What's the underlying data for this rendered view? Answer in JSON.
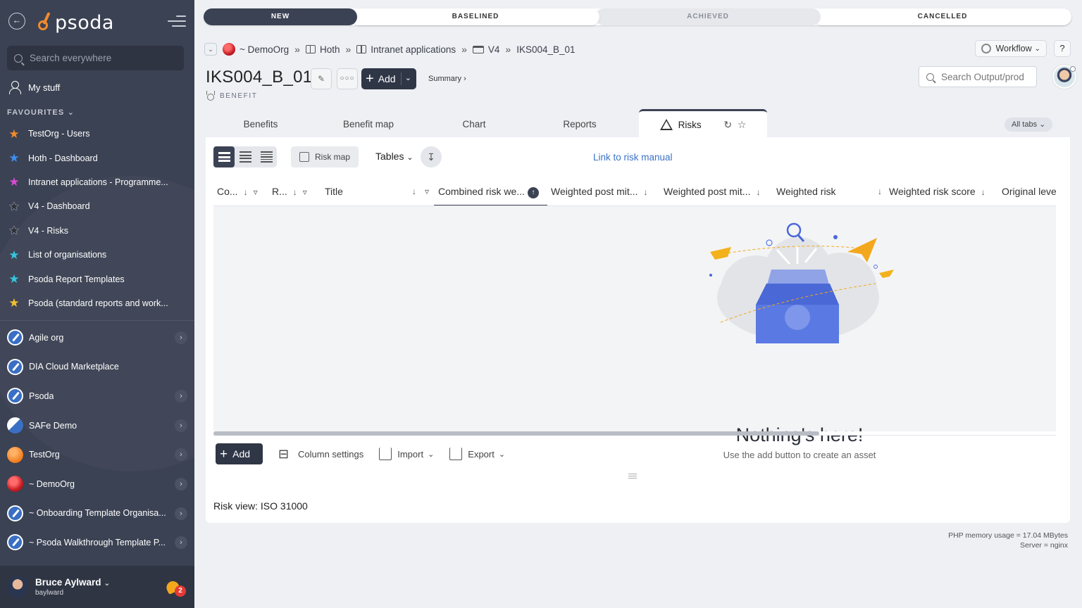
{
  "sidebar": {
    "search_placeholder": "Search everywhere",
    "logo_text": "psoda",
    "my_stuff": "My stuff",
    "favourites_label": "FAVOURITES",
    "favourites": [
      {
        "label": "TestOrg - Users",
        "color": "#f28a2e"
      },
      {
        "label": "Hoth - Dashboard",
        "color": "#3d8ef0"
      },
      {
        "label": "Intranet applications - Programme...",
        "color": "#d94bd4"
      },
      {
        "label": "V4 - Dashboard",
        "color": "#2b2f38"
      },
      {
        "label": "V4 - Risks",
        "color": "#2b2f38"
      },
      {
        "label": "List of organisations",
        "color": "#35c6e0"
      },
      {
        "label": "Psoda Report Templates",
        "color": "#35c6e0"
      },
      {
        "label": "Psoda (standard reports and work...",
        "color": "#f2c230"
      }
    ],
    "orgs": [
      {
        "label": "Agile org",
        "expandable": true,
        "icon": "#3a6fc4"
      },
      {
        "label": "DIA Cloud Marketplace",
        "expandable": false,
        "icon": "#3a6fc4"
      },
      {
        "label": "Psoda",
        "expandable": true,
        "icon": "#3a6fc4"
      },
      {
        "label": "SAFe Demo",
        "expandable": true,
        "icon": "#d0d4dc"
      },
      {
        "label": "TestOrg",
        "expandable": true,
        "icon": "#f28a2e"
      },
      {
        "label": "~ DemoOrg",
        "expandable": true,
        "icon": "#d0243a"
      },
      {
        "label": "~ Onboarding Template Organisa...",
        "expandable": true,
        "icon": "#3a6fc4"
      },
      {
        "label": "~ Psoda Walkthrough Template P...",
        "expandable": true,
        "icon": "#3a6fc4"
      }
    ],
    "user": {
      "name": "Bruce Aylward",
      "username": "baylward",
      "notifications": "2"
    }
  },
  "status_stages": [
    {
      "label": "NEW",
      "state": "current"
    },
    {
      "label": "BASELINED",
      "state": "future"
    },
    {
      "label": "ACHIEVED",
      "state": "disabled"
    },
    {
      "label": "CANCELLED",
      "state": "future"
    }
  ],
  "breadcrumb": [
    "~ DemoOrg",
    "Hoth",
    "Intranet applications",
    "V4",
    "IKS004_B_01"
  ],
  "header": {
    "title": "IKS004_B_01",
    "type": "BENEFIT",
    "add_label": "Add",
    "summary_link": "Summary ›",
    "workflow_label": "Workflow",
    "help_label": "?",
    "search_placeholder": "Search Output/prod"
  },
  "tabs": [
    "Benefits",
    "Benefit map",
    "Chart",
    "Reports",
    "Risks"
  ],
  "active_tab": "Risks",
  "all_tabs_label": "All tabs",
  "toolbar": {
    "risk_map": "Risk map",
    "tables": "Tables",
    "risk_manual_link": "Link to risk manual"
  },
  "columns": [
    "Co...",
    "R...",
    "Title",
    "Combined risk we...",
    "Weighted post mit...",
    "Weighted post mit...",
    "Weighted risk",
    "Weighted risk score",
    "Original leve"
  ],
  "empty_state": {
    "title": "Nothing's here!",
    "subtitle": "Use the add button to create an asset"
  },
  "bottom_bar": {
    "add": "Add",
    "column_settings": "Column settings",
    "import": "Import",
    "export": "Export"
  },
  "risk_view": {
    "label": "Risk view:",
    "value": "ISO 31000"
  },
  "footer": {
    "memory": "PHP memory usage = 17.04 MBytes",
    "server": "Server = nginx"
  },
  "colors": {
    "sidebar_bg": "#3b4253",
    "accent_dark": "#2f3646",
    "link": "#3a72c8"
  }
}
